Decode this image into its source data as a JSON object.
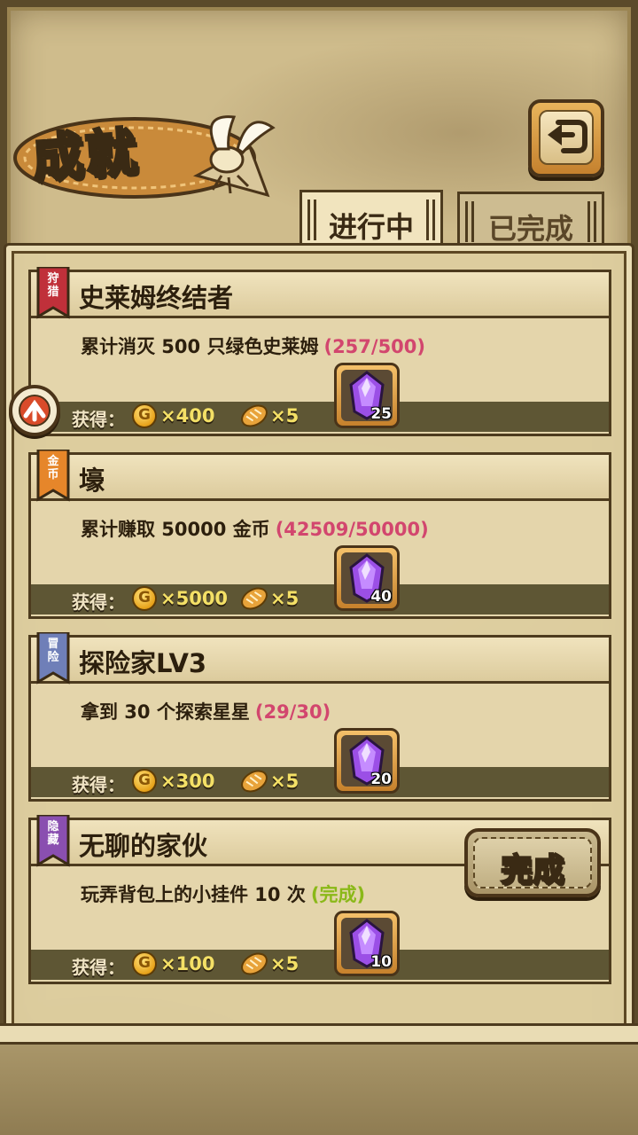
{
  "header": {
    "title": "成就",
    "back_icon": "back-arrow-icon"
  },
  "tabs": [
    {
      "label": "进行中",
      "active": true
    },
    {
      "label": "已完成",
      "active": false
    }
  ],
  "reward_label": "获得：",
  "coin_symbol": "G",
  "achievements": [
    {
      "category": "狩\n猎",
      "category_color": "#c0303a",
      "name": "史莱姆终结者",
      "description": "累计消灭 500 只绿色史莱姆",
      "progress": "(257/500)",
      "coins": "×400",
      "bread": "×5",
      "gems": "25",
      "completed": false
    },
    {
      "category": "金\n币",
      "category_color": "#e6862a",
      "name": "壕",
      "description": "累计赚取 50000 金币",
      "progress": "(42509/50000)",
      "coins": "×5000",
      "bread": "×5",
      "gems": "40",
      "completed": false
    },
    {
      "category": "冒\n险",
      "category_color": "#6f7fb8",
      "name": "探险家LV3",
      "description": "拿到 30 个探索星星",
      "progress": "(29/30)",
      "coins": "×300",
      "bread": "×5",
      "gems": "20",
      "completed": false
    },
    {
      "category": "隐\n藏",
      "category_color": "#8a4fb0",
      "name": "无聊的家伙",
      "description": "玩弄背包上的小挂件 10 次",
      "progress": "(完成)",
      "coins": "×100",
      "bread": "×5",
      "gems": "10",
      "completed": true
    }
  ],
  "complete_button": "完成",
  "colors": {
    "progress": "#d2466e",
    "done": "#8ab818",
    "reward_amount": "#f4e066"
  }
}
